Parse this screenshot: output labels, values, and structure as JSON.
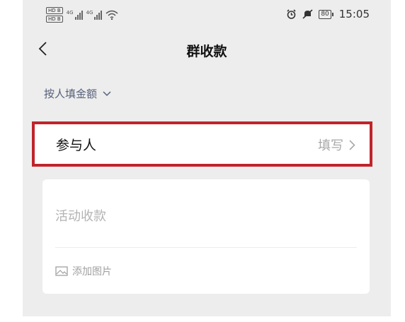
{
  "status_bar": {
    "sim_labels": [
      "HD B",
      "HD B"
    ],
    "signal_label": "4G",
    "battery": "80",
    "time": "15:05"
  },
  "nav": {
    "title": "群收款"
  },
  "mode": {
    "label": "按人填金额"
  },
  "participants": {
    "label": "参与人",
    "action": "填写"
  },
  "activity": {
    "placeholder": "活动收款",
    "add_image": "添加图片"
  },
  "colors": {
    "highlight_border": "#c0242b",
    "link_text": "#56607a",
    "page_bg": "#ededed"
  }
}
